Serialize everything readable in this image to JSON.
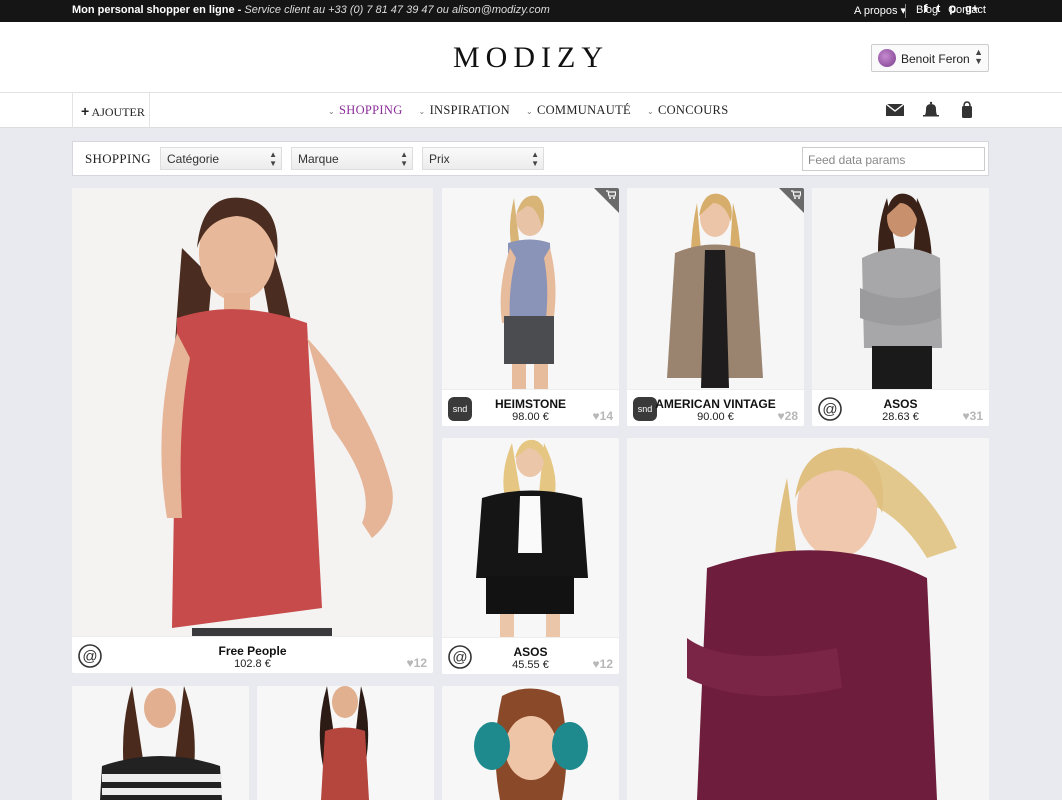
{
  "topbar": {
    "promo_bold": "Mon personal shopper en ligne -",
    "promo_italic": "Service client au +33 (0) 7 81 47 39 47 ou alison@modizy.com",
    "links": [
      "A propos ▾",
      "Blog",
      "Contact"
    ],
    "social": [
      "f",
      "t",
      "p",
      "g+"
    ]
  },
  "header": {
    "logo": "MODIZY",
    "user_name": "Benoit Feron"
  },
  "nav": {
    "add_label": "AJOUTER",
    "menu": [
      {
        "label": "SHOPPING",
        "active": true
      },
      {
        "label": "INSPIRATION",
        "active": false
      },
      {
        "label": "COMMUNAUTÉ",
        "active": false
      },
      {
        "label": "CONCOURS",
        "active": false
      }
    ],
    "icons": [
      "mail-icon",
      "bell-icon",
      "shopping-bag-icon"
    ]
  },
  "filters": {
    "label": "SHOPPING",
    "category": "Catégorie",
    "brand": "Marque",
    "price": "Prix",
    "feed_placeholder": "Feed data params"
  },
  "colors": {
    "accent": "#8d2f9a",
    "background": "#e9eaf0",
    "topbar": "#151515"
  },
  "products": [
    {
      "brand": "Free People",
      "price": "102.8 €",
      "likes": "12",
      "shop": "asos-at-logo",
      "top": "red lace tank top"
    },
    {
      "brand": "HEIMSTONE",
      "price": "98.00 €",
      "likes": "14",
      "shop": "snd",
      "top": "printed tank"
    },
    {
      "brand": "AMERICAN VINTAGE",
      "price": "90.00 €",
      "likes": "28",
      "shop": "snd",
      "top": "taupe cardigan"
    },
    {
      "brand": "ASOS",
      "price": "28.63 €",
      "likes": "31",
      "shop": "asos-at-logo",
      "top": "grey sweater"
    },
    {
      "brand": "ASOS",
      "price": "45.55 €",
      "likes": "12",
      "shop": "asos-at-logo",
      "top": "black blazer"
    }
  ],
  "snd_label": "snd"
}
